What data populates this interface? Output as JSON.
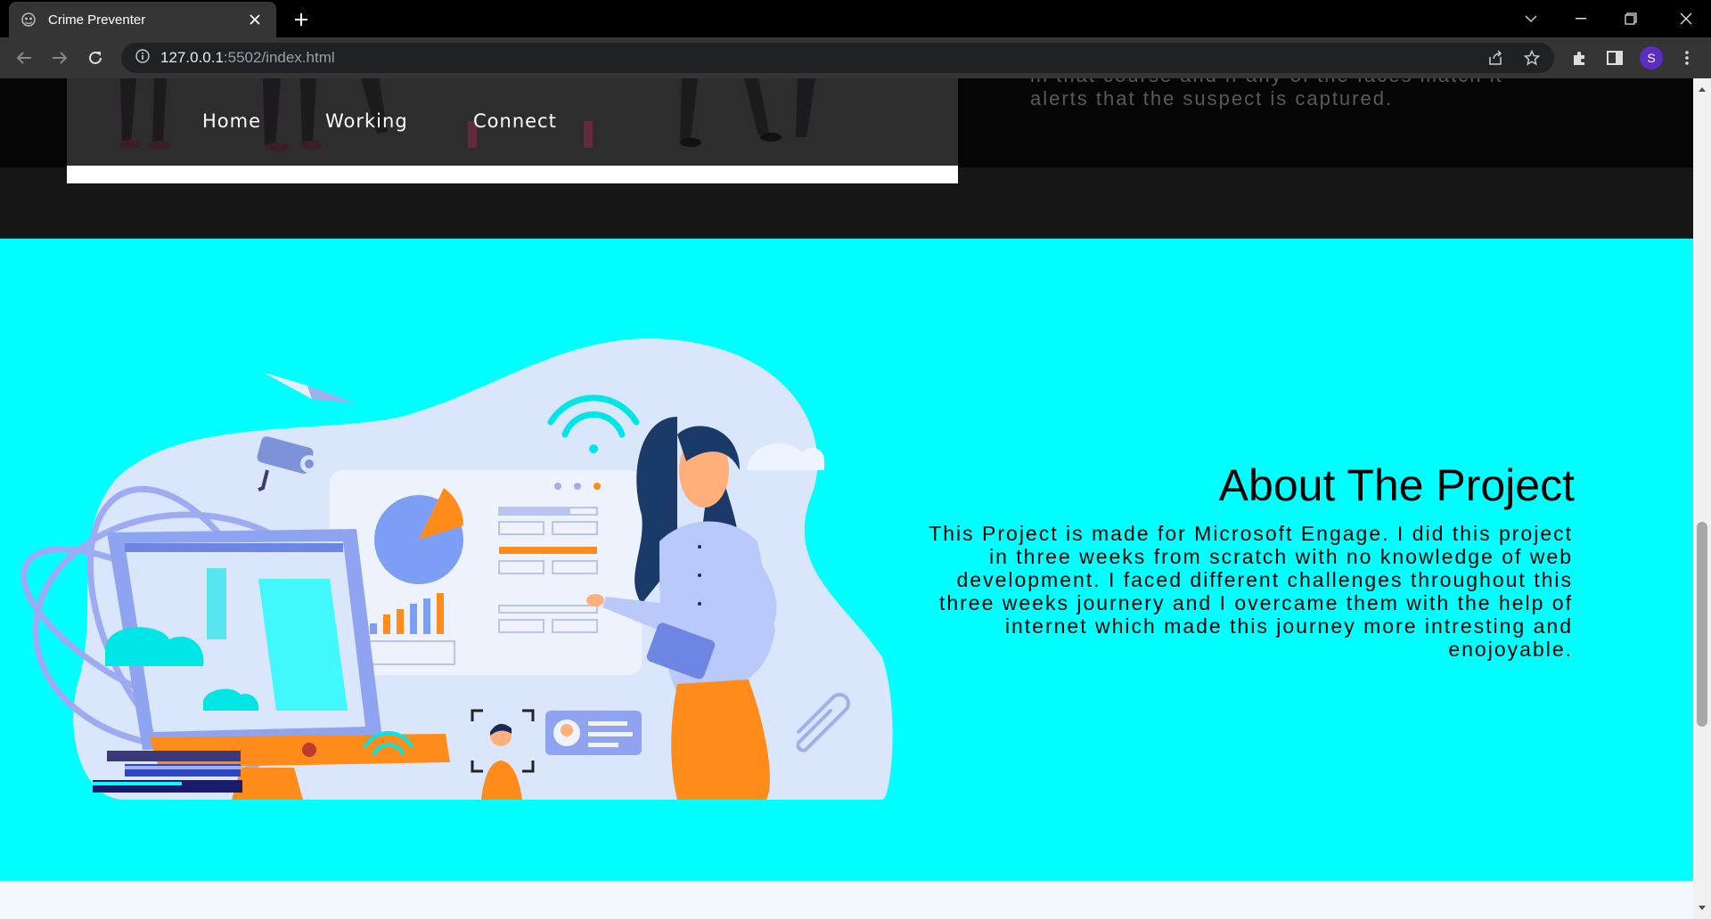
{
  "browser": {
    "tab_title": "Crime Preventer",
    "url_host": "127.0.0.1",
    "url_rest": ":5502/index.html",
    "profile_initial": "S"
  },
  "hero": {
    "nav": [
      "Home",
      "Working",
      "Connect"
    ],
    "faded_line1": "in that course and if any of the faces match it",
    "faded_line2": "alerts that the suspect is captured."
  },
  "about": {
    "title": "About The Project",
    "body": "This Project is made for Microsoft Engage. I did this project in three weeks from scratch with no knowledge of web development. I faced different challenges throughout this three weeks journery and I overcame them with the help of internet which made this journey more intresting and enojoyable."
  },
  "colors": {
    "about_bg": "#00ffff",
    "accent_orange": "#ff8c1a",
    "accent_blue": "#7c9ff5"
  }
}
